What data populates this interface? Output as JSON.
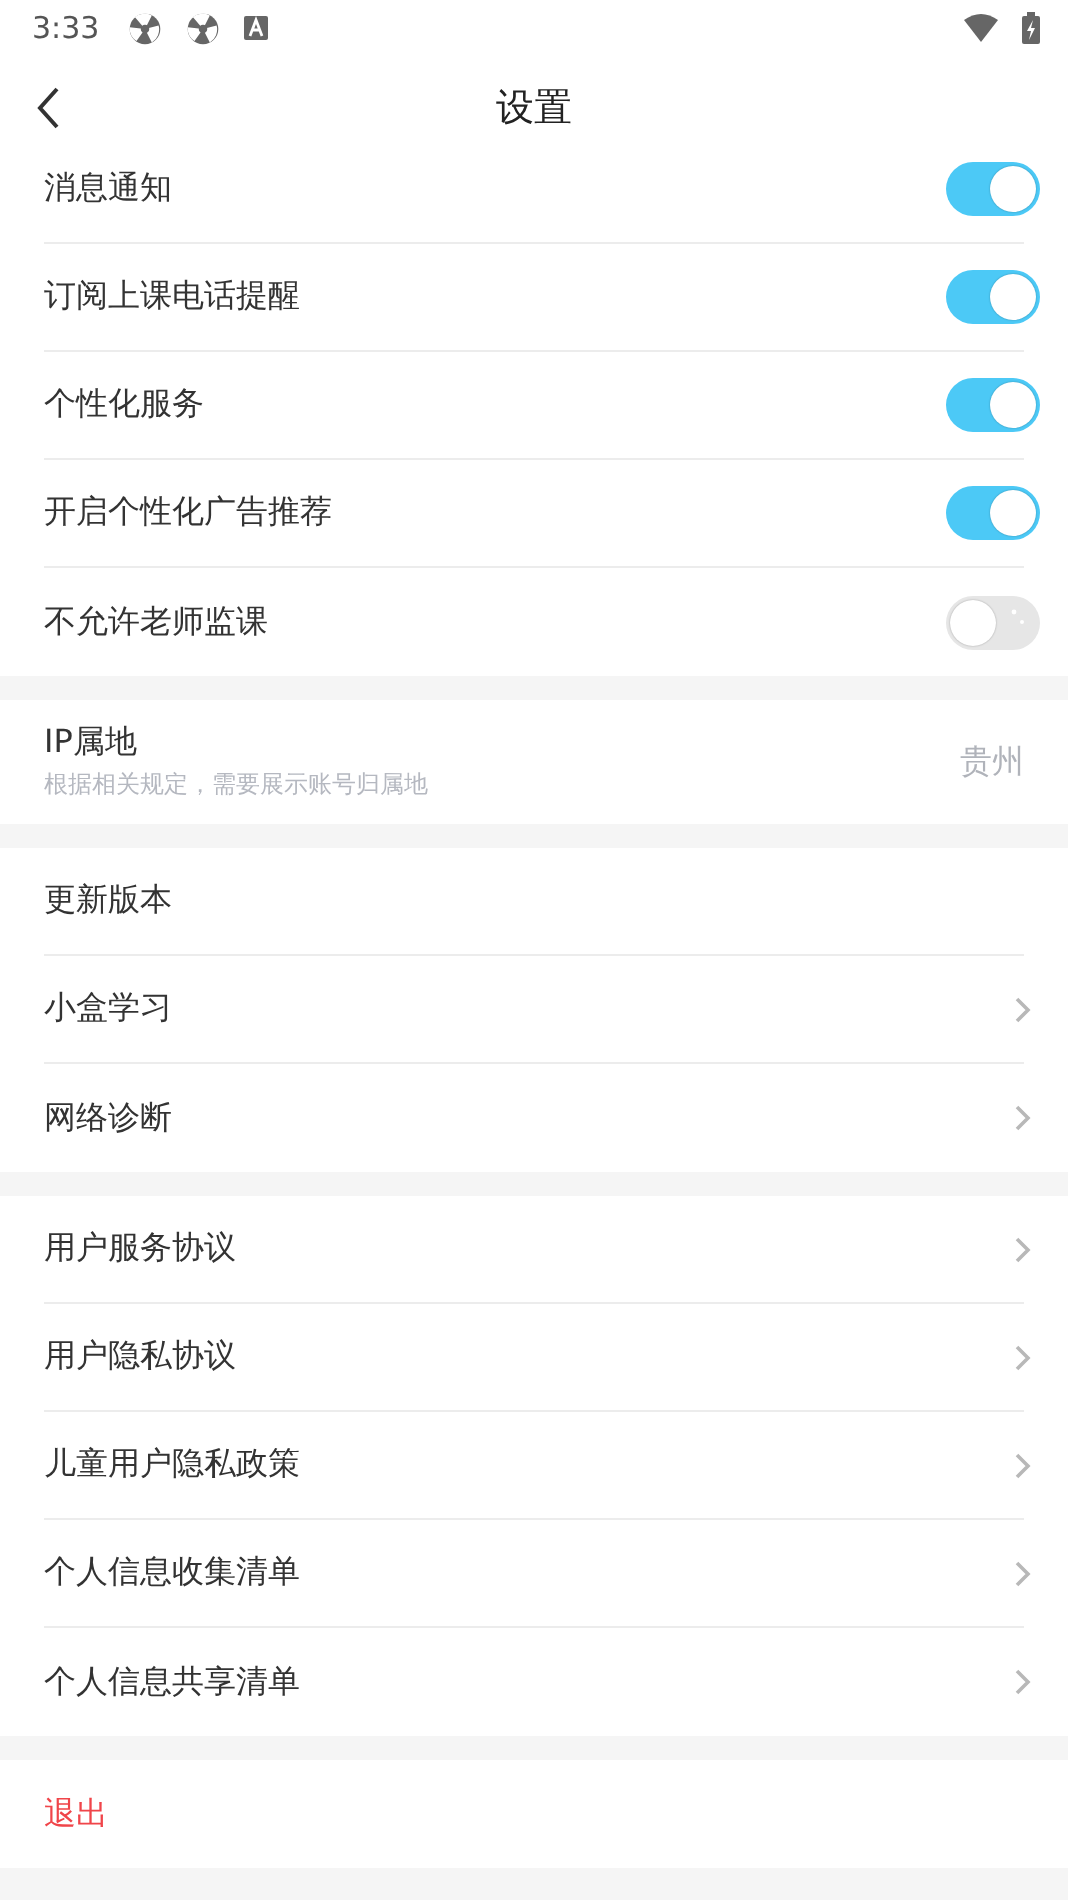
{
  "status_bar": {
    "time": "3:33"
  },
  "header": {
    "title": "设置"
  },
  "sections": [
    {
      "rows": [
        {
          "kind": "toggle",
          "label": "消息通知",
          "on": true
        },
        {
          "kind": "toggle",
          "label": "订阅上课电话提醒",
          "on": true
        },
        {
          "kind": "toggle",
          "label": "个性化服务",
          "on": true
        },
        {
          "kind": "toggle",
          "label": "开启个性化广告推荐",
          "on": true
        },
        {
          "kind": "toggle",
          "label": "不允许老师监课",
          "on": false
        }
      ]
    },
    {
      "rows": [
        {
          "kind": "info",
          "label": "IP属地",
          "hint": "根据相关规定，需要展示账号归属地",
          "value": "贵州"
        }
      ]
    },
    {
      "rows": [
        {
          "kind": "plain",
          "label": "更新版本"
        },
        {
          "kind": "link",
          "label": "小盒学习"
        },
        {
          "kind": "link",
          "label": "网络诊断"
        }
      ]
    },
    {
      "rows": [
        {
          "kind": "link",
          "label": "用户服务协议"
        },
        {
          "kind": "link",
          "label": "用户隐私协议"
        },
        {
          "kind": "link",
          "label": "儿童用户隐私政策"
        },
        {
          "kind": "link",
          "label": "个人信息收集清单"
        },
        {
          "kind": "link",
          "label": "个人信息共享清单"
        }
      ]
    },
    {
      "rows": [
        {
          "kind": "logout",
          "label": "退出"
        }
      ]
    }
  ]
}
